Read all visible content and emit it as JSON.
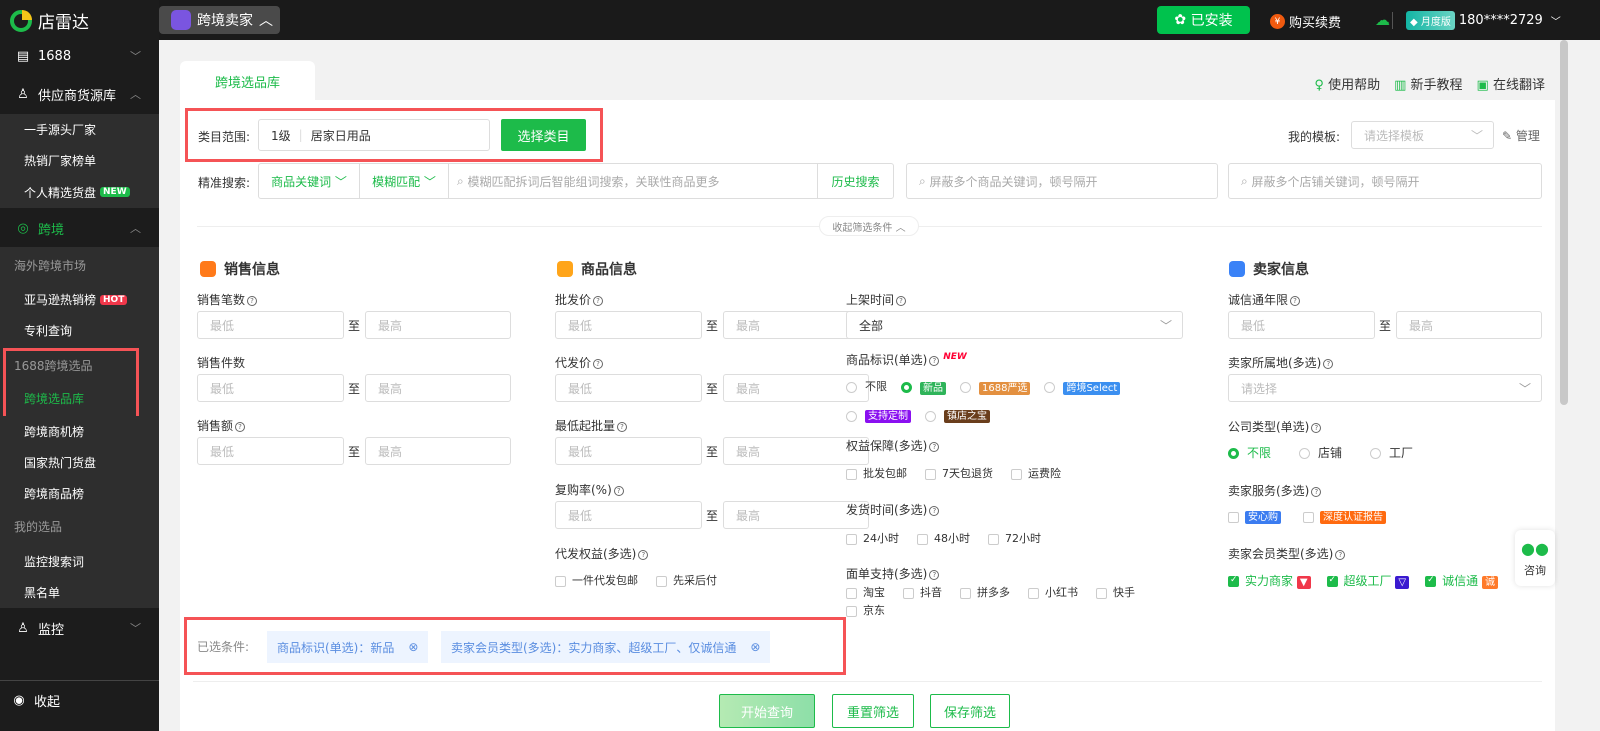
{
  "app": {
    "logo": "店雷达",
    "switcher": "跨境卖家"
  },
  "topbar": {
    "installed": "已安装",
    "renew": "购买续费",
    "plan": "月度版",
    "user": "180****2729"
  },
  "sidebar": {
    "items": [
      {
        "label": "1688"
      },
      {
        "label": "供应商货源库"
      },
      {
        "label": "跨境"
      },
      {
        "label": "监控"
      }
    ],
    "supplier_sub": [
      "一手源头厂家",
      "热销厂家榜单",
      "个人精选货盘"
    ],
    "new_badge": "NEW",
    "hot_badge": "HOT",
    "cross_groups": [
      "海外跨境市场",
      "1688跨境选品",
      "我的选品"
    ],
    "cross_sub": [
      "亚马逊热销榜",
      "专利查询",
      "跨境选品库",
      "跨境商机榜",
      "国家热门货盘",
      "跨境商品榜",
      "监控搜索词",
      "黑名单"
    ],
    "collapse": "收起"
  },
  "tab": "跨境选品库",
  "help": [
    "使用帮助",
    "新手教程",
    "在线翻译"
  ],
  "category": {
    "label": "类目范围:",
    "level": "1级",
    "value": "居家日用品",
    "button": "选择类目"
  },
  "template": {
    "label": "我的模板:",
    "placeholder": "请选择模板",
    "manage": "管理"
  },
  "search": {
    "label": "精准搜索:",
    "type": "商品关键词",
    "match": "模糊匹配",
    "placeholder": "模糊匹配拆词后智能组词搜索，关联性商品更多",
    "history": "历史搜索",
    "block_product": "屏蔽多个商品关键词，顿号隔开",
    "block_shop": "屏蔽多个店铺关键词，顿号隔开"
  },
  "collapse_filters": "收起筛选条件",
  "min": "最低",
  "max": "最高",
  "to": "至",
  "sales": {
    "title": "销售信息",
    "fields": [
      "销售笔数",
      "销售件数",
      "销售额"
    ]
  },
  "product": {
    "title": "商品信息",
    "fields": [
      "批发价",
      "代发价",
      "最低起批量",
      "复购率(%)"
    ],
    "dropship_label": "代发权益(多选)",
    "dropship_opts": [
      "一件代发包邮",
      "先采后付"
    ],
    "listing_label": "上架时间",
    "listing_value": "全部",
    "mark_label": "商品标识(单选)",
    "mark_new": "NEW",
    "mark_opts": [
      "不限",
      "新品",
      "1688严选",
      "跨境Select",
      "支持定制",
      "镇店之宝"
    ],
    "rights_label": "权益保障(多选)",
    "rights_opts": [
      "批发包邮",
      "7天包退货",
      "运费险"
    ],
    "ship_label": "发货时间(多选)",
    "ship_opts": [
      "24小时",
      "48小时",
      "72小时"
    ],
    "waybill_label": "面单支持(多选)",
    "waybill_opts": [
      "淘宝",
      "抖音",
      "拼多多",
      "小红书",
      "快手",
      "京东"
    ]
  },
  "seller": {
    "title": "卖家信息",
    "years_label": "诚信通年限",
    "region_label": "卖家所属地(多选)",
    "region_placeholder": "请选择",
    "company_label": "公司类型(单选)",
    "company_opts": [
      "不限",
      "店铺",
      "工厂"
    ],
    "service_label": "卖家服务(多选)",
    "service_opts": [
      "安心购",
      "深度认证报告"
    ],
    "member_label": "卖家会员类型(多选)",
    "member_opts": [
      "实力商家",
      "超级工厂",
      "诚信通"
    ]
  },
  "selected": {
    "label": "已选条件:",
    "chips": [
      "商品标识(单选)：新品",
      "卖家会员类型(多选)：实力商家、超级工厂、仅诚信通"
    ]
  },
  "actions": {
    "query": "开始查询",
    "reset": "重置筛选",
    "save": "保存筛选"
  },
  "consult": "咨询",
  "colors": {
    "green": "#1dbb4a",
    "red": "#f55356"
  }
}
